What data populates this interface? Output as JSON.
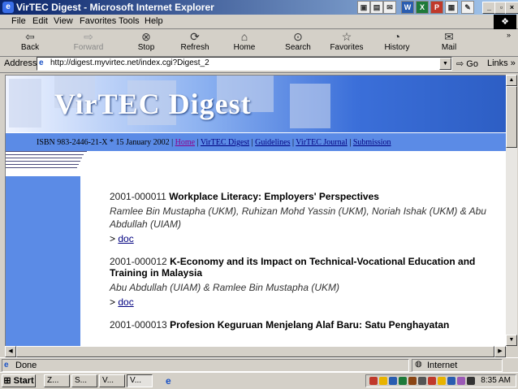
{
  "window": {
    "title": "VirTEC Digest - Microsoft Internet Explorer"
  },
  "menu": [
    "File",
    "Edit",
    "View",
    "Favorites",
    "Tools",
    "Help"
  ],
  "toolbar": {
    "back": "Back",
    "forward": "Forward",
    "stop": "Stop",
    "refresh": "Refresh",
    "home": "Home",
    "search": "Search",
    "favorites": "Favorites",
    "history": "History",
    "mail": "Mail"
  },
  "address": {
    "label": "Address",
    "url": "http://digest.myvirtec.net/index.cgi?Digest_2",
    "go": "Go",
    "links": "Links"
  },
  "page": {
    "banner_title": "VirTEC Digest",
    "issue_info": "ISBN 983-2446-21-X * 15 January 2002 |",
    "nav": [
      "Home",
      "VirTEC Digest",
      "Guidelines",
      "VirTEC Journal",
      "Submission"
    ],
    "entries": [
      {
        "number": "2001-000011",
        "title": "Workplace Literacy: Employers' Perspectives",
        "authors": "Ramlee Bin Mustapha (UKM), Ruhizan Mohd Yassin (UKM), Noriah Ishak (UKM) & Abu Abdullah (UIAM)",
        "prefix": ">",
        "doc": "doc"
      },
      {
        "number": "2001-000012",
        "title": "K-Economy and its Impact on Technical-Vocational Education and Training in Malaysia",
        "authors": "Abu Abdullah (UIAM) & Ramlee Bin Mustapha (UKM)",
        "prefix": ">",
        "doc": "doc"
      },
      {
        "number": "2001-000013",
        "title": "Profesion Keguruan Menjelang Alaf Baru: Satu Penghayatan",
        "authors": "",
        "prefix": "",
        "doc": ""
      }
    ]
  },
  "status": {
    "text": "Done",
    "zone": "Internet"
  },
  "taskbar": {
    "start": "Start",
    "tasks": [
      "Z...",
      "S...",
      "V...",
      "V..."
    ],
    "clock": "8:35 AM"
  }
}
